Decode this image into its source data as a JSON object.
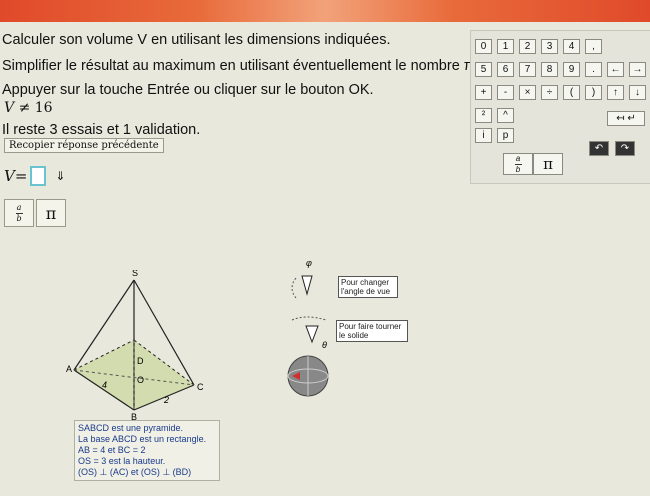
{
  "instructions": {
    "line1": "Calculer son volume V en utilisant les dimensions indiquées.",
    "line2": "Simplifier le résultat au maximum en utilisant éventuellement le nombre π",
    "line3": "Appuyer sur la touche Entrée ou cliquer sur le bouton OK.",
    "inequality_left": "V",
    "inequality_op": "≠",
    "inequality_right": "16",
    "attempts": "Il reste 3 essais et 1 validation.",
    "recopy_button": "Recopier réponse précédente"
  },
  "answer": {
    "label": "V=",
    "value": "",
    "arrow": "⇓"
  },
  "quick_buttons": {
    "fraction": "a/b",
    "pi": "π"
  },
  "keypad": {
    "row1": [
      "0",
      "1",
      "2",
      "3",
      "4",
      ","
    ],
    "row2": [
      "5",
      "6",
      "7",
      "8",
      "9",
      ".",
      "←",
      "→"
    ],
    "row3": [
      "+",
      "-",
      "×",
      "÷",
      "(",
      ")",
      "↑",
      "↓"
    ],
    "row4": [
      "²",
      "^"
    ],
    "row5": [
      "i",
      "p"
    ],
    "pi": "π",
    "fraction": "a/b"
  },
  "figure": {
    "vertices": {
      "S": "S",
      "A": "A",
      "B": "B",
      "C": "C",
      "D": "D",
      "O": "O"
    },
    "label_4": "4",
    "label_2": "2",
    "angle_symbol_phi": "φ",
    "angle_symbol_theta": "θ",
    "tooltip_view": "Pour changer l'angle de vue",
    "tooltip_rotate": "Pour faire tourner le solide"
  },
  "info": {
    "line1": "SABCD est une pyramide.",
    "line2": "La base ABCD est un rectangle.",
    "line3": "AB = 4 et BC = 2",
    "line4": "OS = 3 est la hauteur.",
    "line5": "(OS) ⊥ (AC) et (OS) ⊥ (BD)"
  },
  "colors": {
    "accent_orange": "#e04a2a",
    "answer_border": "#6cc3d0",
    "info_text": "#1a3a8a",
    "base_fill": "#c9d79a"
  }
}
